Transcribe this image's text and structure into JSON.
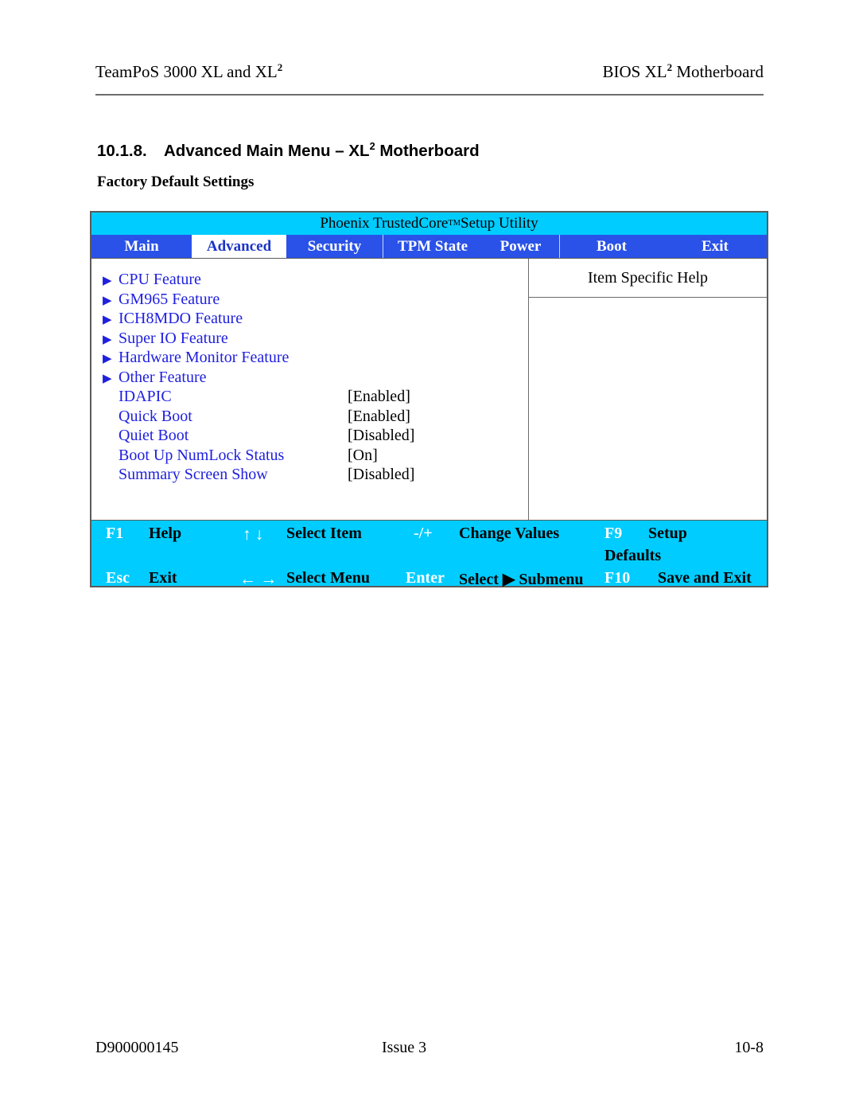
{
  "page_header": {
    "left_prefix": "TeamPoS 3000 XL and XL",
    "left_sup": "2",
    "right_prefix": "BIOS XL",
    "right_sup": "2",
    "right_suffix": " Motherboard"
  },
  "headings": {
    "section_number": "10.1.8.",
    "section_title_prefix": "Advanced Main Menu – XL",
    "section_title_sup": "2",
    "section_title_suffix": " Motherboard",
    "sub_heading": "Factory Default Settings"
  },
  "bios": {
    "title_prefix": "Phoenix TrustedCore",
    "title_sup": "TM",
    "title_suffix": " Setup Utility",
    "tabs": [
      {
        "label": "Main",
        "selected": false
      },
      {
        "label": "Advanced",
        "selected": true
      },
      {
        "label": "Security",
        "selected": false
      },
      {
        "label": "TPM State",
        "selected": false
      },
      {
        "label": "Power",
        "selected": false
      },
      {
        "label": "Boot",
        "selected": false
      },
      {
        "label": "Exit",
        "selected": false
      }
    ],
    "help_title": "Item Specific Help",
    "menu_items": [
      {
        "submenu": true,
        "arrow": "▶",
        "label": "CPU Feature",
        "value": ""
      },
      {
        "submenu": true,
        "arrow": "▶",
        "label": "GM965 Feature",
        "value": ""
      },
      {
        "submenu": true,
        "arrow": "▶",
        "label": "ICH8MDO Feature",
        "value": ""
      },
      {
        "submenu": true,
        "arrow": "▶",
        "label": "Super IO Feature",
        "value": ""
      },
      {
        "submenu": true,
        "arrow": "▶",
        "label": "Hardware Monitor Feature",
        "value": ""
      },
      {
        "submenu": true,
        "arrow": "▶",
        "label": "Other Feature",
        "value": ""
      },
      {
        "submenu": false,
        "arrow": "",
        "label": "IDAPIC",
        "value": "[Enabled]"
      },
      {
        "submenu": false,
        "arrow": "",
        "label": "Quick Boot",
        "value": "[Enabled]"
      },
      {
        "submenu": false,
        "arrow": "",
        "label": "Quiet Boot",
        "value": "[Disabled]"
      },
      {
        "submenu": false,
        "arrow": "",
        "label": "Boot Up NumLock Status",
        "value": "[On]"
      },
      {
        "submenu": false,
        "arrow": "",
        "label": "Summary Screen Show",
        "value": "[Disabled]"
      }
    ],
    "footer": {
      "f1_key": "F1",
      "f1_desc": "Help",
      "updown_arrows": "↑ ↓",
      "updown_desc": "Select Item",
      "plusminus_key": "-/+",
      "plusminus_desc": "Change Values",
      "f9_key": "F9",
      "f9_desc": "Setup",
      "f9_desc2": "Defaults",
      "esc_key": "Esc",
      "esc_desc": "Exit",
      "leftright_arrows": "← →",
      "leftright_desc": "Select Menu",
      "enter_key": "Enter",
      "enter_desc_pre": "Select",
      "enter_desc_arrow": "▶",
      "enter_desc_post": "Submenu",
      "f10_key": "F10",
      "f10_desc": "Save and Exit"
    }
  },
  "page_footer": {
    "doc_number": "D900000145",
    "issue": "Issue 3",
    "page_number": "10-8"
  },
  "colors": {
    "title_bar": "#00CCFF",
    "tab_bar": "#2A52E8",
    "menu_label": "#2020E0",
    "selected_tab_text": "#1a34c8",
    "footer_bar": "#00CCFF"
  }
}
